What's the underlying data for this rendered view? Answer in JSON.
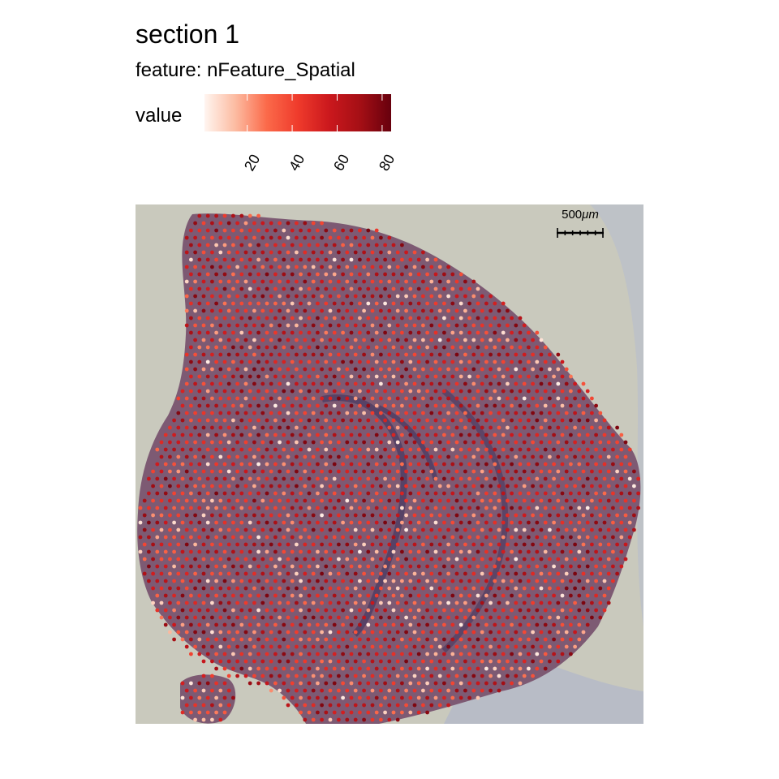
{
  "chart_data": {
    "type": "scatter",
    "title": "section 1",
    "subtitle_prefix": "feature:",
    "feature": "nFeature_Spatial",
    "legend": {
      "title": "value",
      "ticks": [
        "20",
        "40",
        "60",
        "80"
      ],
      "tick_values": [
        20,
        40,
        60,
        80
      ],
      "range": [
        1,
        84
      ],
      "colors": [
        "#fff5f0",
        "#fcbba1",
        "#fb6a4a",
        "#ef3b2c",
        "#cb181d",
        "#a50f15",
        "#67000d"
      ]
    },
    "scalebar": {
      "label": "500",
      "unit": "μm"
    },
    "background": {
      "image": "H&E tissue section",
      "color": "#c9c9bd"
    },
    "spots": {
      "count": 1730,
      "note": "grid of spatial spots colored by nFeature_Spatial"
    }
  }
}
